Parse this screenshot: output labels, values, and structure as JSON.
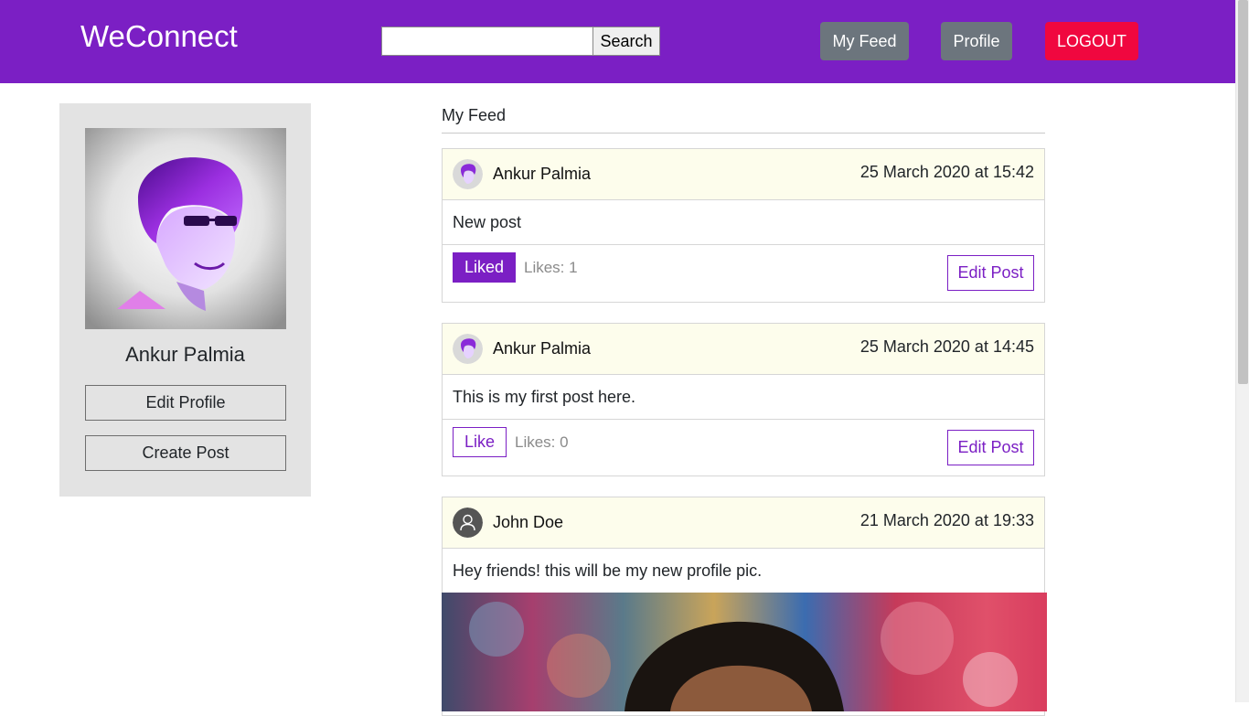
{
  "app": {
    "brand": "WeConnect"
  },
  "nav": {
    "search_placeholder": "",
    "search_button": "Search",
    "my_feed": "My Feed",
    "profile": "Profile",
    "logout": "LOGOUT"
  },
  "sidebar": {
    "name": "Ankur Palmia",
    "edit_profile": "Edit Profile",
    "create_post": "Create Post"
  },
  "feed": {
    "title": "My Feed",
    "posts": [
      {
        "author": "Ankur Palmia",
        "avatar": "stylized-portrait-avatar",
        "date": "25 March 2020 at 15:42",
        "text": "New post",
        "like_label": "Liked",
        "likes": "Likes: 1",
        "edit_label": "Edit Post"
      },
      {
        "author": "Ankur Palmia",
        "avatar": "stylized-portrait-avatar",
        "date": "25 March 2020 at 14:45",
        "text": "This is my first post here.",
        "like_label": "Like",
        "likes": "Likes: 0",
        "edit_label": "Edit Post"
      },
      {
        "author": "John Doe",
        "avatar": "default-user-icon",
        "date": "21 March 2020 at 19:33",
        "text": "Hey friends! this will be my new profile pic."
      }
    ]
  },
  "colors": {
    "navbar": "#7b1fc4",
    "accent": "#7b1fc4",
    "logout": "#f0073f",
    "secondary_button": "#6c757d",
    "post_header": "#fdfdec",
    "sidebar_card": "#e3e3e3"
  }
}
